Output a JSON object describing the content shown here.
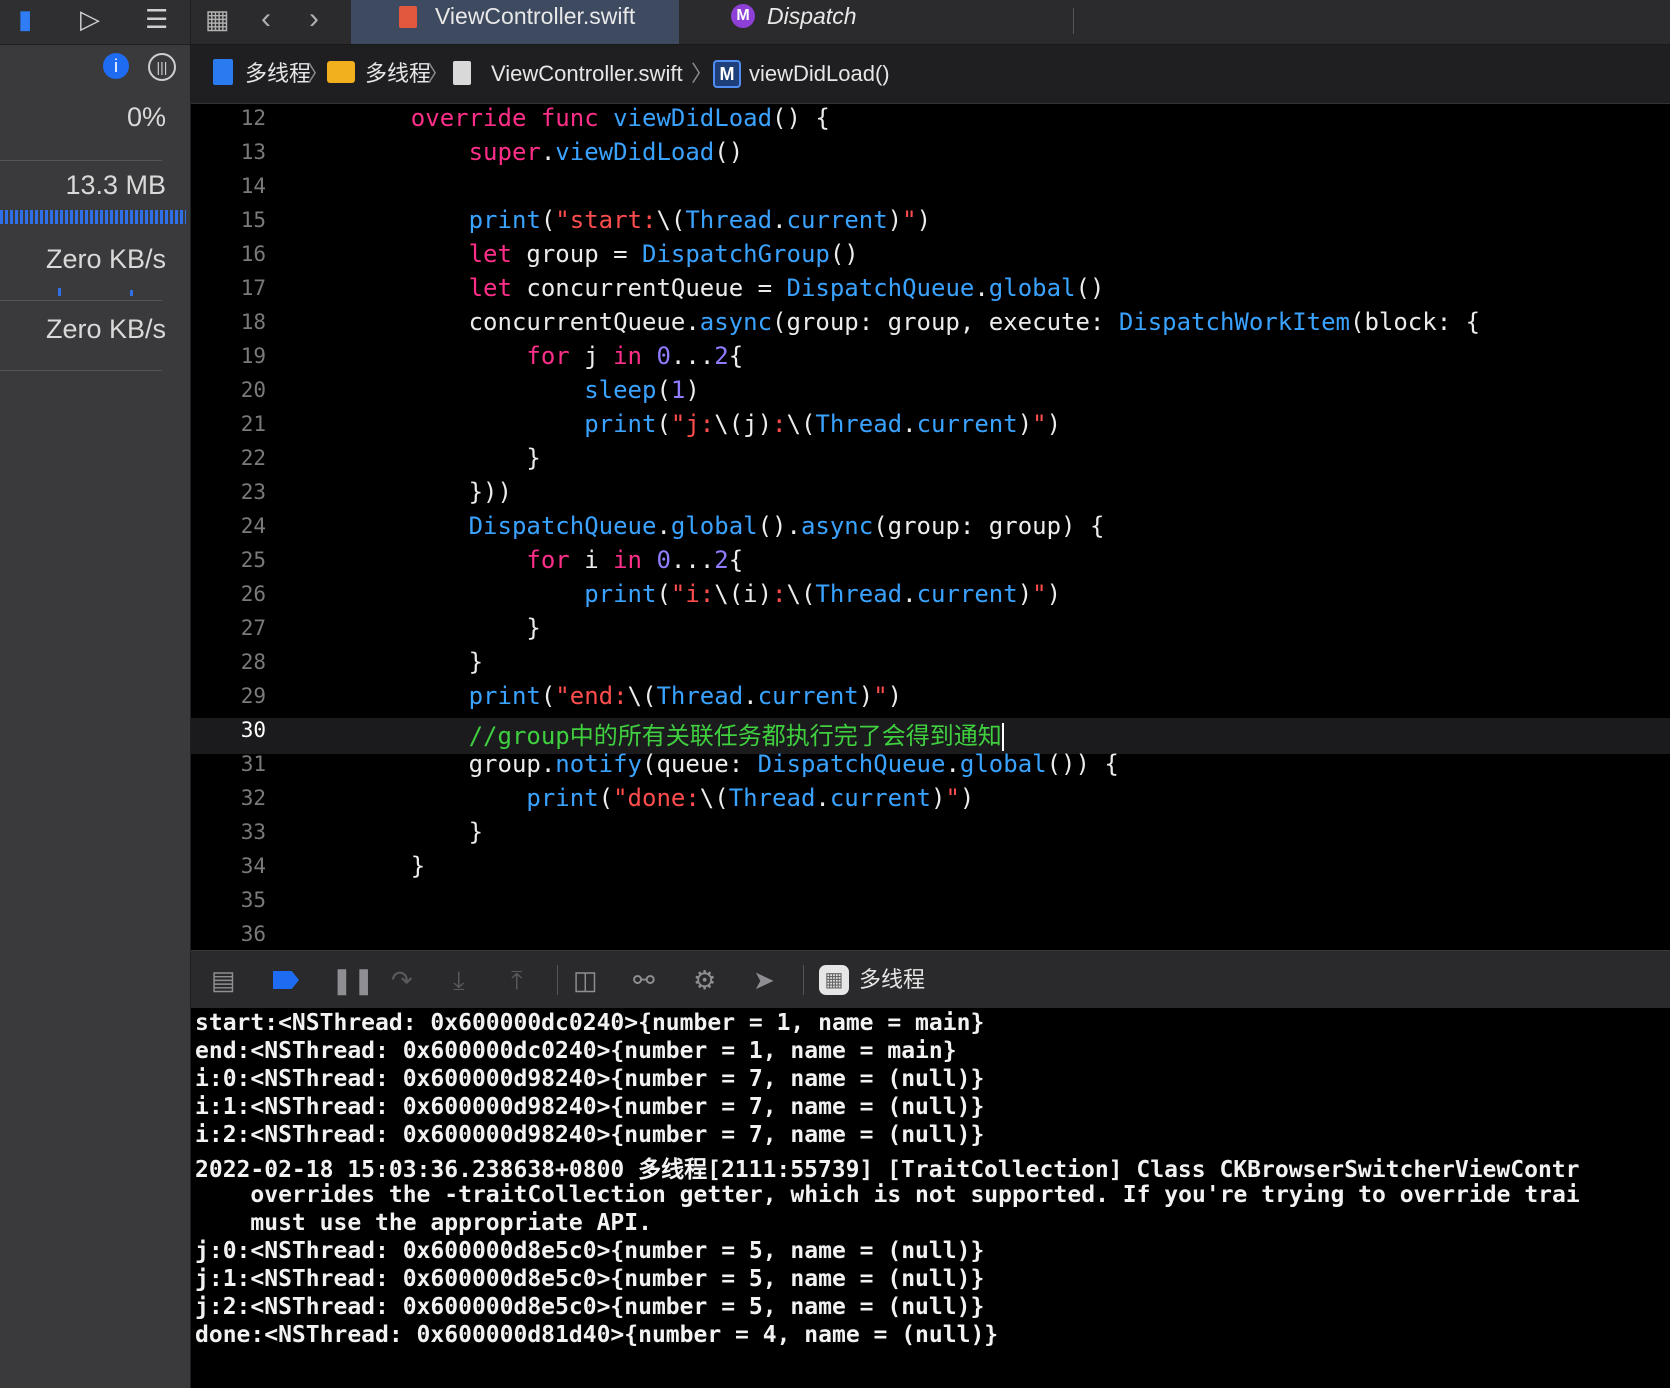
{
  "sidebar": {
    "cpu_percent": "0%",
    "memory": "13.3 MB",
    "disk_speed": "Zero KB/s",
    "network_speed": "Zero KB/s"
  },
  "tabs": [
    {
      "label": "ViewController.swift",
      "active": true
    },
    {
      "label": "Dispatch",
      "active": false
    }
  ],
  "breadcrumb": {
    "project": "多线程",
    "folder": "多线程",
    "file": "ViewController.swift",
    "symbol": "viewDidLoad()"
  },
  "editor": {
    "lines": [
      {
        "n": "12",
        "tokens": [
          [
            "",
            "    "
          ],
          [
            "kw",
            "override"
          ],
          [
            "",
            " "
          ],
          [
            "kw",
            "func"
          ],
          [
            "",
            " "
          ],
          [
            "fn",
            "viewDidLoad"
          ],
          [
            "",
            "() {"
          ]
        ]
      },
      {
        "n": "13",
        "tokens": [
          [
            "",
            "        "
          ],
          [
            "kw",
            "super"
          ],
          [
            "",
            "."
          ],
          [
            "fn",
            "viewDidLoad"
          ],
          [
            "",
            "()"
          ]
        ]
      },
      {
        "n": "14",
        "tokens": []
      },
      {
        "n": "15",
        "tokens": [
          [
            "",
            "        "
          ],
          [
            "fn",
            "print"
          ],
          [
            "",
            "("
          ],
          [
            "str",
            "\"start:"
          ],
          [
            "",
            "\\("
          ],
          [
            "fn",
            "Thread"
          ],
          [
            "",
            "."
          ],
          [
            "fn",
            "current"
          ],
          [
            "",
            ")"
          ],
          [
            "str",
            "\""
          ],
          [
            "",
            ")"
          ]
        ]
      },
      {
        "n": "16",
        "tokens": [
          [
            "",
            "        "
          ],
          [
            "kw",
            "let"
          ],
          [
            "",
            " group = "
          ],
          [
            "fn",
            "DispatchGroup"
          ],
          [
            "",
            "()"
          ]
        ]
      },
      {
        "n": "17",
        "tokens": [
          [
            "",
            "        "
          ],
          [
            "kw",
            "let"
          ],
          [
            "",
            " concurrentQueue = "
          ],
          [
            "fn",
            "DispatchQueue"
          ],
          [
            "",
            "."
          ],
          [
            "fn",
            "global"
          ],
          [
            "",
            "()"
          ]
        ]
      },
      {
        "n": "18",
        "tokens": [
          [
            "",
            "        concurrentQueue."
          ],
          [
            "fn",
            "async"
          ],
          [
            "",
            "(group: group, execute: "
          ],
          [
            "fn",
            "DispatchWorkItem"
          ],
          [
            "",
            "(block: {"
          ]
        ]
      },
      {
        "n": "19",
        "tokens": [
          [
            "",
            "            "
          ],
          [
            "kw",
            "for"
          ],
          [
            "",
            " j "
          ],
          [
            "kw",
            "in"
          ],
          [
            "",
            " "
          ],
          [
            "num",
            "0"
          ],
          [
            "",
            "..."
          ],
          [
            "num",
            "2"
          ],
          [
            "",
            "{"
          ]
        ]
      },
      {
        "n": "20",
        "tokens": [
          [
            "",
            "                "
          ],
          [
            "fn",
            "sleep"
          ],
          [
            "",
            "("
          ],
          [
            "num",
            "1"
          ],
          [
            "",
            ")"
          ]
        ]
      },
      {
        "n": "21",
        "tokens": [
          [
            "",
            "                "
          ],
          [
            "fn",
            "print"
          ],
          [
            "",
            "("
          ],
          [
            "str",
            "\"j:"
          ],
          [
            "",
            "\\(j)"
          ],
          [
            "str",
            ":"
          ],
          [
            "",
            "\\("
          ],
          [
            "fn",
            "Thread"
          ],
          [
            "",
            "."
          ],
          [
            "fn",
            "current"
          ],
          [
            "",
            ")"
          ],
          [
            "str",
            "\""
          ],
          [
            "",
            ")"
          ]
        ]
      },
      {
        "n": "22",
        "tokens": [
          [
            "",
            "            }"
          ]
        ]
      },
      {
        "n": "23",
        "tokens": [
          [
            "",
            "        }))"
          ]
        ]
      },
      {
        "n": "24",
        "tokens": [
          [
            "",
            "        "
          ],
          [
            "fn",
            "DispatchQueue"
          ],
          [
            "",
            "."
          ],
          [
            "fn",
            "global"
          ],
          [
            "",
            "()."
          ],
          [
            "fn",
            "async"
          ],
          [
            "",
            "(group: group) {"
          ]
        ]
      },
      {
        "n": "25",
        "tokens": [
          [
            "",
            "            "
          ],
          [
            "kw",
            "for"
          ],
          [
            "",
            " i "
          ],
          [
            "kw",
            "in"
          ],
          [
            "",
            " "
          ],
          [
            "num",
            "0"
          ],
          [
            "",
            "..."
          ],
          [
            "num",
            "2"
          ],
          [
            "",
            "{"
          ]
        ]
      },
      {
        "n": "26",
        "tokens": [
          [
            "",
            "                "
          ],
          [
            "fn",
            "print"
          ],
          [
            "",
            "("
          ],
          [
            "str",
            "\"i:"
          ],
          [
            "",
            "\\(i)"
          ],
          [
            "str",
            ":"
          ],
          [
            "",
            "\\("
          ],
          [
            "fn",
            "Thread"
          ],
          [
            "",
            "."
          ],
          [
            "fn",
            "current"
          ],
          [
            "",
            ")"
          ],
          [
            "str",
            "\""
          ],
          [
            "",
            ")"
          ]
        ]
      },
      {
        "n": "27",
        "tokens": [
          [
            "",
            "            }"
          ]
        ]
      },
      {
        "n": "28",
        "tokens": [
          [
            "",
            "        }"
          ]
        ]
      },
      {
        "n": "29",
        "tokens": [
          [
            "",
            "        "
          ],
          [
            "fn",
            "print"
          ],
          [
            "",
            "("
          ],
          [
            "str",
            "\"end:"
          ],
          [
            "",
            "\\("
          ],
          [
            "fn",
            "Thread"
          ],
          [
            "",
            "."
          ],
          [
            "fn",
            "current"
          ],
          [
            "",
            ")"
          ],
          [
            "str",
            "\""
          ],
          [
            "",
            ")"
          ]
        ]
      },
      {
        "n": "30",
        "tokens": [
          [
            "",
            "        "
          ],
          [
            "cm",
            "//group中的所有关联任务都执行完了会得到通知"
          ]
        ],
        "current": true
      },
      {
        "n": "31",
        "tokens": [
          [
            "",
            "        group."
          ],
          [
            "fn",
            "notify"
          ],
          [
            "",
            "(queue: "
          ],
          [
            "fn",
            "DispatchQueue"
          ],
          [
            "",
            "."
          ],
          [
            "fn",
            "global"
          ],
          [
            "",
            "()) {"
          ]
        ]
      },
      {
        "n": "32",
        "tokens": [
          [
            "",
            "            "
          ],
          [
            "fn",
            "print"
          ],
          [
            "",
            "("
          ],
          [
            "str",
            "\"done:"
          ],
          [
            "",
            "\\("
          ],
          [
            "fn",
            "Thread"
          ],
          [
            "",
            "."
          ],
          [
            "fn",
            "current"
          ],
          [
            "",
            ")"
          ],
          [
            "str",
            "\""
          ],
          [
            "",
            ")"
          ]
        ]
      },
      {
        "n": "33",
        "tokens": [
          [
            "",
            "        }"
          ]
        ]
      },
      {
        "n": "34",
        "tokens": [
          [
            "",
            "    }"
          ]
        ]
      },
      {
        "n": "35",
        "tokens": []
      },
      {
        "n": "36",
        "tokens": []
      }
    ]
  },
  "debug": {
    "target": "多线程"
  },
  "console": {
    "lines": [
      "start:<NSThread: 0x600000dc0240>{number = 1, name = main}",
      "end:<NSThread: 0x600000dc0240>{number = 1, name = main}",
      "i:0:<NSThread: 0x600000d98240>{number = 7, name = (null)}",
      "i:1:<NSThread: 0x600000d98240>{number = 7, name = (null)}",
      "i:2:<NSThread: 0x600000d98240>{number = 7, name = (null)}",
      "2022-02-18 15:03:36.238638+0800 多线程[2111:55739] [TraitCollection] Class CKBrowserSwitcherViewContr",
      "    overrides the -traitCollection getter, which is not supported. If you're trying to override trai",
      "    must use the appropriate API.",
      "j:0:<NSThread: 0x600000d8e5c0>{number = 5, name = (null)}",
      "j:1:<NSThread: 0x600000d8e5c0>{number = 5, name = (null)}",
      "j:2:<NSThread: 0x600000d8e5c0>{number = 5, name = (null)}",
      "done:<NSThread: 0x600000d81d40>{number = 4, name = (null)}"
    ]
  },
  "colors": {
    "keyword": "#ff2f89",
    "function": "#3aa3ff",
    "string": "#ff4d4d",
    "number": "#8f7dff",
    "comment": "#3fcf3f",
    "accent": "#1e6cf2"
  }
}
